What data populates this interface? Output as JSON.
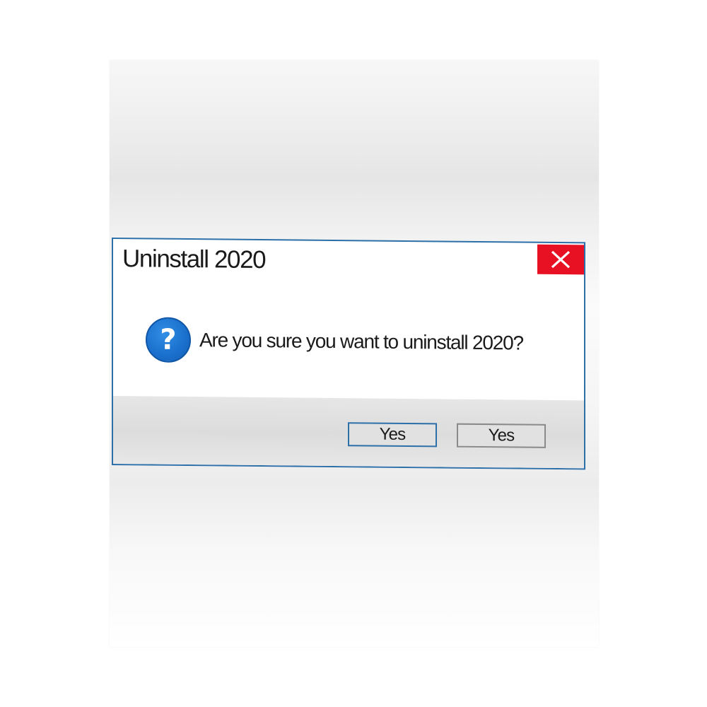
{
  "dialog": {
    "title": "Uninstall 2020",
    "message": "Are you sure you want to uninstall 2020?",
    "icon": "question-icon",
    "close_icon": "close-icon",
    "buttons": [
      {
        "label": "Yes"
      },
      {
        "label": "Yes"
      }
    ]
  },
  "colors": {
    "border": "#2d6fa9",
    "close_bg": "#e81123",
    "icon_bg": "#1a6fcc",
    "footer_bg": "#dcdcdc"
  }
}
